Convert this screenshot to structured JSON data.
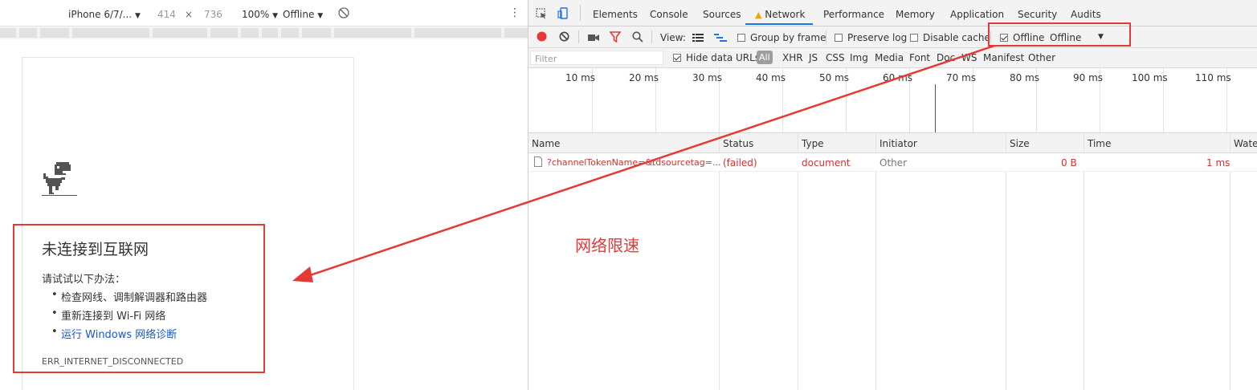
{
  "device_toolbar": {
    "device": "iPhone 6/7/...",
    "width": "414",
    "times": "×",
    "height": "736",
    "zoom": "100%",
    "throttle": "Offline"
  },
  "error_page": {
    "title": "未连接到互联网",
    "try_label": "请试试以下办法：",
    "suggestions": [
      "检查网线、调制解调器和路由器",
      "重新连接到 Wi-Fi 网络"
    ],
    "diag_link": "运行 Windows 网络诊断",
    "error_code": "ERR_INTERNET_DISCONNECTED"
  },
  "devtools": {
    "tabs": [
      "Elements",
      "Console",
      "Sources",
      "Network",
      "Performance",
      "Memory",
      "Application",
      "Security",
      "Audits"
    ],
    "active_tab": "Network",
    "toolbar": {
      "view_label": "View:",
      "group_by_frame": "Group by frame",
      "preserve_log": "Preserve log",
      "disable_cache": "Disable cache",
      "offline_checkbox": "Offline",
      "throttle_value": "Offline"
    },
    "filter": {
      "placeholder": "Filter",
      "hide_data_urls": "Hide data URLs",
      "types": [
        "All",
        "XHR",
        "JS",
        "CSS",
        "Img",
        "Media",
        "Font",
        "Doc",
        "WS",
        "Manifest",
        "Other"
      ]
    },
    "timeline_ticks": [
      "10 ms",
      "20 ms",
      "30 ms",
      "40 ms",
      "50 ms",
      "60 ms",
      "70 ms",
      "80 ms",
      "90 ms",
      "100 ms",
      "110 ms"
    ],
    "columns": [
      "Name",
      "Status",
      "Type",
      "Initiator",
      "Size",
      "Time",
      "Waterfall"
    ],
    "rows": [
      {
        "name": "?channelTokenName=&tdsourcetag=...",
        "status": "(failed)",
        "type": "document",
        "initiator": "Other",
        "size": "0 B",
        "time": "1 ms"
      }
    ]
  },
  "annotation": {
    "label": "网络限速",
    "color": "#e53935"
  }
}
